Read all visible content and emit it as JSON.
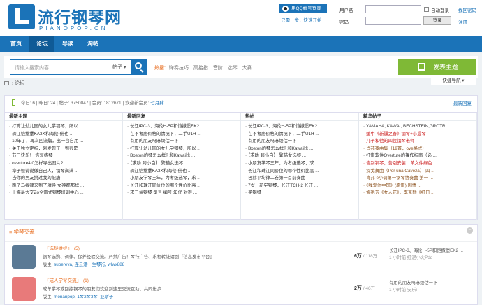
{
  "header": {
    "site_name": "流行钢琴网",
    "site_sub": "PIANOPOP.CN",
    "qq_login": "用QQ帐号登录",
    "qq_tip": "只需一步，快速开始",
    "username_label": "用户名",
    "password_label": "密码",
    "auto_login": "自动登录",
    "find_password": "找回密码",
    "login_button": "登录",
    "register": "注册"
  },
  "nav": {
    "items": [
      "首页",
      "论坛",
      "导读",
      "淘帖"
    ],
    "quick_nav": "快捷导航"
  },
  "search": {
    "placeholder": "请输入搜索内容",
    "type": "帖子",
    "hot_label": "热搜:",
    "hot_terms": [
      "弹奏技巧",
      "高抬指",
      "音阶",
      "选琴",
      "大赛"
    ],
    "post_button": "发表主题"
  },
  "breadcrumb": "论坛",
  "stats": {
    "today": "今日: 6",
    "yesterday": "昨日: 24",
    "posts": "帖子: 3750047",
    "members": "会员: 1812671",
    "welcome": "欢迎新会员:",
    "new_member": "七月肆",
    "latest_reply": "最新回复"
  },
  "columns": [
    {
      "title": "最新主题",
      "items": [
        "打算让幼儿园的女儿学钢琴，所以 ...",
        "珠江恺撒堡KA3X和海伦-佛也 ...",
        "10年了，再次回流弱，出一台自用 ...",
        "关于独立定指，刚发现了一到很是",
        "节日快乐！ 恢复练琴",
        "overture4.0怎样导出图片?",
        "章子恒说说做自己人，钢琴满满 ...",
        "当你的男友挑过我的能唐",
        "跑了马福律来到了精导 女神都那样 ...",
        "上海最大交Zo全谱式钢琴培训中心 ..."
      ]
    },
    {
      "title": "最新回复",
      "items": [
        "长江IPC-3、海伦H-5P和恺撒堡EK2 ...",
        "在不考虑价格的情况下，二手U1H ...",
        "有用的朋友吗麻烦估一下",
        "打算让幼儿园的女儿学钢琴，所以 ...",
        "Boston的琴怎么样? 和Kawai比 ...",
        "【求助 跨小白】 繁猫女选琴 ...",
        "珠江恺撒堡KA3X和海伦-佛也 ...",
        "小朋友学琴三年，为考级选琴，求 ...",
        "长江和珠江同价位的哪个性价比高 ...",
        "求三益钢琴 型号 编号 年代 对得 ..."
      ]
    },
    {
      "title": "热帖",
      "items": [
        "长江IPC-3、海伦H-5P和恺撒堡EK2 ...",
        "在不考虑价格的情况下，二手U1H ...",
        "有用的朋友吗麻烦估一下",
        "Boston的琴怎么样? 和Kawai比 ...",
        "【求助 跨小白】 繁猫女选琴 ...",
        "小朋友学琴三年，为考级选琴，求 ...",
        "长江和珠江同价位的哪个性价比高 ...",
        "巴赫平均律二卷第一首前奏曲",
        "7岁，新学钢琴，长江TCH-2 长江 ...",
        "买钢琴"
      ]
    },
    {
      "title": "精华帖子",
      "items": [
        "YAMAHA, KAWAI, BECHSTEIN,GROTR ...",
        "缓中《新疆之春》钢琴+小提琴",
        "儿子和他的四位钢琴老师",
        "肖邦夜曲集（19首，ove格式）",
        "打谱软件Overture的操作指南（必 ...",
        "告别钢琴，告别安装！单文件绿色 ...",
        "探戈舞曲（Por una Caveza）-四 ...",
        "肖邦 e小调第一钢琴协奏曲 第一 ...",
        "《我爱你中国》(原谱) 剧情 ...",
        "悔艳芳《女人花》，李克勤《红日 ..."
      ],
      "styles": [
        "",
        "red",
        "red",
        "brn",
        "",
        "red",
        "brn",
        "brn",
        "brn",
        "brn"
      ]
    }
  ],
  "section": {
    "title": "≡ 学琴交流",
    "forums": [
      {
        "name": "『选琴维护』",
        "today": "(5)",
        "desc": "钢琴选购、调律、保养经验交流。严禁广告！琴行广告、求租转让请到『信息发布平台』",
        "mod_label": "版主: ",
        "mods": "supereva, 连云港一生琴行, wlwx888",
        "count": "6万",
        "total": " / 118万",
        "last_title": "长江IPC-3、海伦H-5P和恺撒堡EK2 ...",
        "last_time": "1 小时前 红泥小火Pdd",
        "color": "#5b7a95"
      },
      {
        "name": "『成人学琴交流』",
        "today": "(1)",
        "desc": "成年学琴或回拣钢琴的朋友们欢迎到这里交流互助、共同进步",
        "mod_label": "版主: ",
        "mods": "monanpop, 1琴2琴3琴, 亚斯子",
        "count": "2万",
        "total": " / 46万",
        "last_title": "有用的朋友吗麻烦估一下",
        "last_time": "1 小时前 安乐i",
        "color": "#e87a7a"
      }
    ]
  }
}
